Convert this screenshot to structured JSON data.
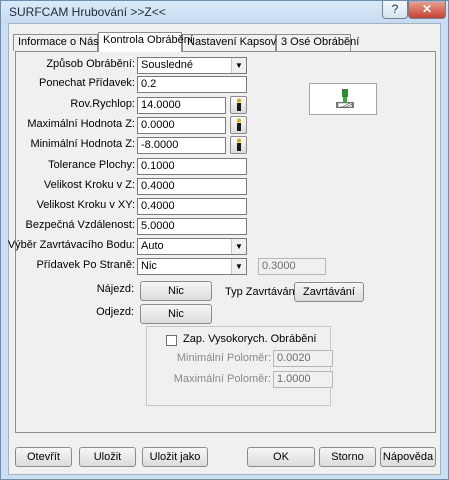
{
  "window": {
    "title": "SURFCAM Hrubování >>Z<<",
    "help_label": "?",
    "close_label": "✕"
  },
  "tabs": [
    {
      "label": "Informace o Nástroji",
      "active": false
    },
    {
      "label": "Kontrola Obrábění",
      "active": true
    },
    {
      "label": "Nastavení Kapsování",
      "active": false
    },
    {
      "label": "3 Osé Obrábění",
      "active": false
    }
  ],
  "form": {
    "zpusob": {
      "label": "Způsob Obrábění:",
      "value": "Sousledné"
    },
    "ponechat": {
      "label": "Ponechat Přídavek:",
      "value": "0.2"
    },
    "rov": {
      "label": "Rov.Rychlop:",
      "value": "14.0000"
    },
    "maxz": {
      "label": "Maximální Hodnota Z:",
      "value": "0.0000"
    },
    "minz": {
      "label": "Minimální Hodnota Z:",
      "value": "-8.0000"
    },
    "tolerance": {
      "label": "Tolerance Plochy:",
      "value": "0.1000"
    },
    "krokz": {
      "label": "Velikost Kroku v Z:",
      "value": "0.4000"
    },
    "krokxy": {
      "label": "Velikost Kroku v XY:",
      "value": "0.4000"
    },
    "bezpecna": {
      "label": "Bezpečná Vzdálenost:",
      "value": "5.0000"
    },
    "vyber": {
      "label": "Výběr Zavrtávacího Bodu:",
      "value": "Auto"
    },
    "pridavek": {
      "label": "Přídavek Po Straně:",
      "value": "Nic",
      "extra_value": "0.3000"
    },
    "najezd": {
      "label": "Nájezd:",
      "button": "Nic"
    },
    "typ": {
      "label": "Typ Zavrtávání:",
      "button": "Zavrtávání"
    },
    "odjezd": {
      "label": "Odjezd:",
      "button": "Nic"
    },
    "highspeed": {
      "label": "Zap. Vysokorych. Obrábění",
      "checked": false
    },
    "minpolomer": {
      "label": "Minimální Poloměr:",
      "value": "0.0020"
    },
    "maxpolomer": {
      "label": "Maximální Poloměr:",
      "value": "1.0000"
    }
  },
  "buttons": {
    "otevrit": "Otevřít",
    "ulozit": "Uložit",
    "ulozit_jako": "Uložit jako",
    "ok": "OK",
    "storno": "Storno",
    "napoveda": "Nápověda"
  },
  "icons": {
    "dropdown": "chevron-down-icon",
    "pick": "pick-point-icon",
    "preview": "tool-preview-icon"
  }
}
